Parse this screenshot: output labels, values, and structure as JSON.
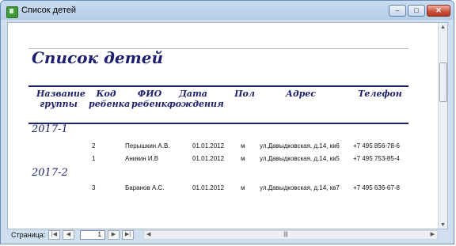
{
  "window": {
    "title": "Список детей",
    "btn_min": "–",
    "btn_max": "□",
    "btn_close": "✕"
  },
  "report": {
    "title": "Список детей",
    "headers": {
      "group": [
        "Название",
        "группы"
      ],
      "code": [
        "Код",
        "ребенка"
      ],
      "fio": [
        "ФИО",
        "ребенка"
      ],
      "date": [
        "Дата",
        "рождения"
      ],
      "sex": "Пол",
      "address": "Адрес",
      "phone": "Телефон"
    },
    "groups": [
      {
        "name": "2017-1",
        "rows": [
          {
            "code": "2",
            "fio": "Перышкин А.В.",
            "date": "01.01.2012",
            "sex": "м",
            "address": "ул.Давыдковская, д.14, кв6",
            "phone": "+7 495 856-78-6"
          },
          {
            "code": "1",
            "fio": "Аникин И.В",
            "date": "01.01.2012",
            "sex": "м",
            "address": "ул.Давыдковская, д.14, кв5",
            "phone": "+7 495 753-85-4"
          }
        ]
      },
      {
        "name": "2017-2",
        "rows": [
          {
            "code": "3",
            "fio": "Баранов А.С.",
            "date": "01.01.2012",
            "sex": "м",
            "address": "ул.Давыдковская, д.14, кв7",
            "phone": "+7 495 636-67-8"
          }
        ]
      }
    ]
  },
  "statusbar": {
    "pages_label": "Страница:",
    "page": "1",
    "nav": {
      "first": "|◀",
      "prev": "◀",
      "next": "▶",
      "last": "▶|"
    },
    "thumb": "|||"
  }
}
